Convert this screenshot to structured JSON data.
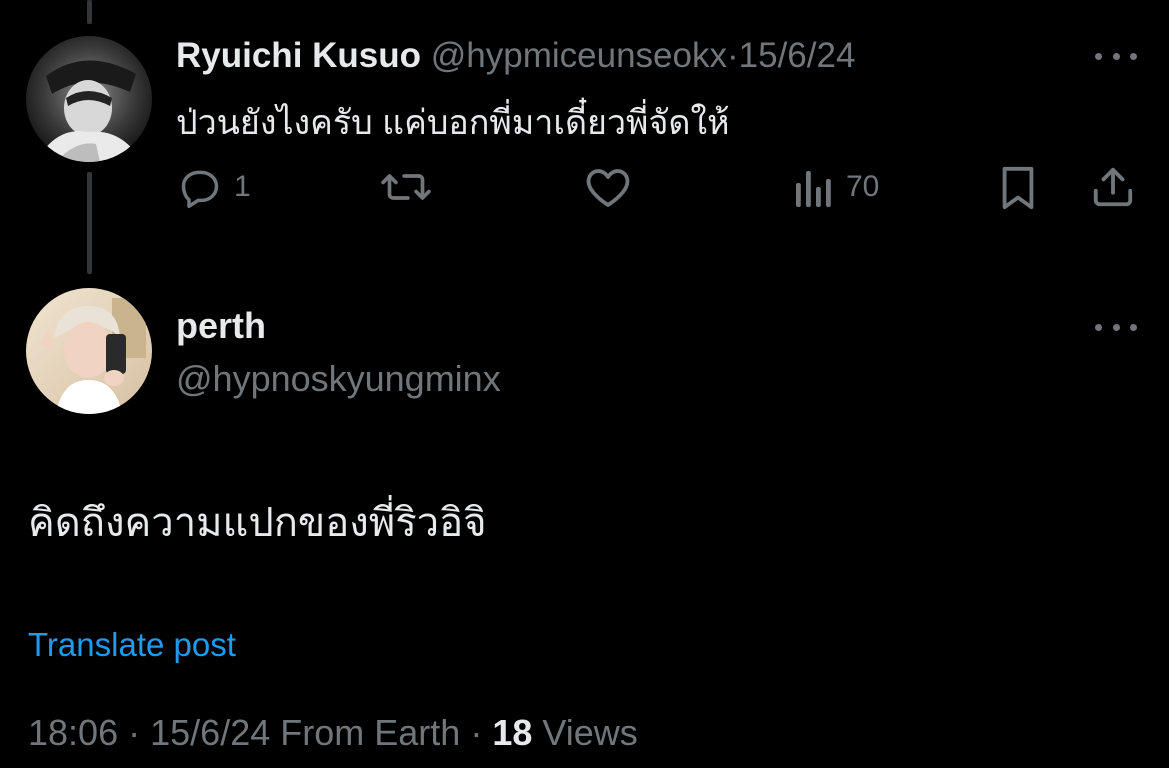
{
  "colors": {
    "background": "#000000",
    "text_primary": "#e7e9ea",
    "text_secondary": "#71767b",
    "link": "#1d9bf0",
    "thread_line": "#333639"
  },
  "parent_post": {
    "display_name": "Ryuichi Kusuo",
    "handle": "@hypmiceunseokx",
    "separator": "·",
    "date": "15/6/24",
    "text": "ป่วนยังไงครับ แค่บอกพี่มาเดี๋ยวพี่จัดให้",
    "actions": {
      "reply_icon": "reply-icon",
      "reply_count": "1",
      "repost_icon": "repost-icon",
      "like_icon": "like-icon",
      "views_icon": "views-icon",
      "views_count": "70",
      "bookmark_icon": "bookmark-icon",
      "share_icon": "share-icon"
    }
  },
  "main_post": {
    "display_name": "perth",
    "handle": "@hypnoskyungminx",
    "text": "คิดถึงความแปกของพี่ริวอิจิ",
    "translate_label": "Translate post",
    "time": "18:06",
    "date": "15/6/24",
    "source": "From Earth",
    "views_count": "18",
    "views_label": "Views",
    "separator": "·"
  }
}
